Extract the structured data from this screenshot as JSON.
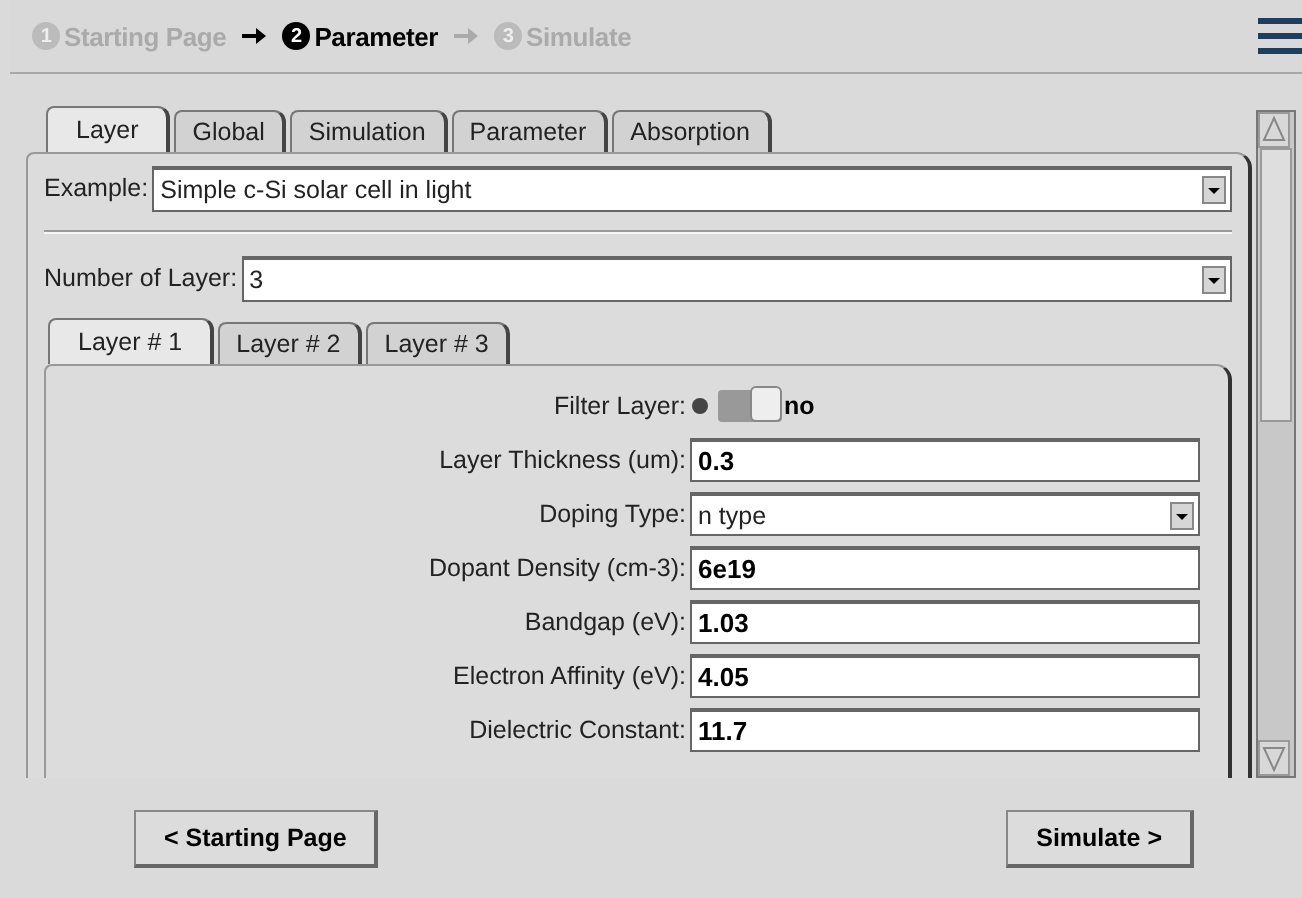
{
  "steps": [
    {
      "number": "1",
      "label": "Starting Page",
      "selected": false
    },
    {
      "number": "2",
      "label": "Parameter",
      "selected": true
    },
    {
      "number": "3",
      "label": "Simulate",
      "selected": false
    }
  ],
  "tabs": [
    {
      "label": "Layer",
      "selected": true
    },
    {
      "label": "Global",
      "selected": false
    },
    {
      "label": "Simulation",
      "selected": false
    },
    {
      "label": "Parameter",
      "selected": false
    },
    {
      "label": "Absorption",
      "selected": false
    }
  ],
  "example": {
    "label": "Example:",
    "value": "Simple c-Si solar cell in light"
  },
  "layer_count": {
    "label": "Number of Layer:",
    "value": "3"
  },
  "layer_tabs": [
    {
      "label": "Layer # 1",
      "selected": true
    },
    {
      "label": "Layer # 2",
      "selected": false
    },
    {
      "label": "Layer # 3",
      "selected": false
    }
  ],
  "fields": [
    {
      "kind": "toggle",
      "label": "Filter Layer:",
      "on": false,
      "value": "no"
    },
    {
      "kind": "text",
      "label": "Layer Thickness (um):",
      "value": "0.3"
    },
    {
      "kind": "dropdown",
      "label": "Doping Type:",
      "value": "n type"
    },
    {
      "kind": "text",
      "label": "Dopant Density (cm-3):",
      "value": "6e19"
    },
    {
      "kind": "text",
      "label": "Bandgap (eV):",
      "value": "1.03"
    },
    {
      "kind": "text",
      "label": "Electron Affinity (eV):",
      "value": "4.05"
    },
    {
      "kind": "text",
      "label": "Dielectric Constant:",
      "value": "11.7"
    }
  ],
  "buttons": [
    {
      "label": "< Starting Page"
    },
    {
      "label": "Simulate >"
    }
  ]
}
